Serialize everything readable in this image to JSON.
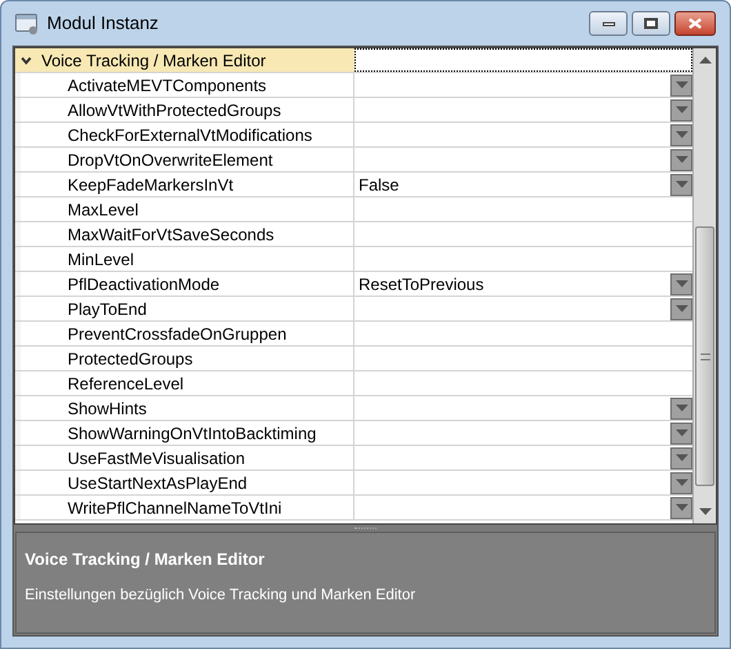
{
  "window": {
    "title": "Modul Instanz"
  },
  "category": {
    "label": "Voice Tracking / Marken Editor",
    "expanded": true
  },
  "properties": [
    {
      "name": "ActivateMEVTComponents",
      "kind": "dropdown"
    },
    {
      "name": "AllowVtWithProtectedGroups",
      "kind": "dropdown"
    },
    {
      "name": "CheckForExternalVtModifications",
      "kind": "dropdown"
    },
    {
      "name": "DropVtOnOverwriteElement",
      "kind": "dropdown"
    },
    {
      "name": "KeepFadeMarkersInVt",
      "kind": "dropdown",
      "value": "False"
    },
    {
      "name": "MaxLevel",
      "kind": "text"
    },
    {
      "name": "MaxWaitForVtSaveSeconds",
      "kind": "text"
    },
    {
      "name": "MinLevel",
      "kind": "text"
    },
    {
      "name": "PflDeactivationMode",
      "kind": "dropdown",
      "value": "ResetToPrevious"
    },
    {
      "name": "PlayToEnd",
      "kind": "dropdown"
    },
    {
      "name": "PreventCrossfadeOnGruppen",
      "kind": "text"
    },
    {
      "name": "ProtectedGroups",
      "kind": "text"
    },
    {
      "name": "ReferenceLevel",
      "kind": "text"
    },
    {
      "name": "ShowHints",
      "kind": "dropdown"
    },
    {
      "name": "ShowWarningOnVtIntoBacktiming",
      "kind": "dropdown"
    },
    {
      "name": "UseFastMeVisualisation",
      "kind": "dropdown"
    },
    {
      "name": "UseStartNextAsPlayEnd",
      "kind": "dropdown"
    },
    {
      "name": "WritePflChannelNameToVtIni",
      "kind": "dropdown"
    }
  ],
  "description": {
    "title": "Voice Tracking / Marken Editor",
    "text": "Einstellungen bezüglich Voice Tracking und Marken Editor"
  }
}
